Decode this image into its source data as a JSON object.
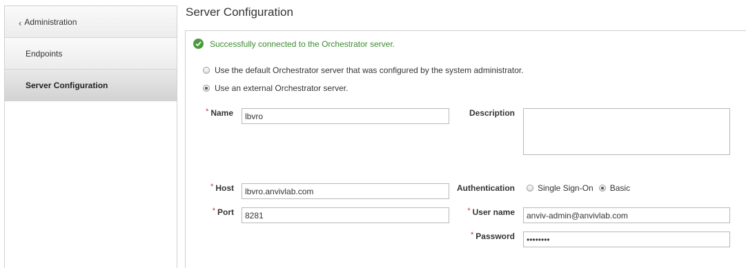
{
  "sidebar": {
    "items": [
      {
        "label": "Administration"
      },
      {
        "label": "Endpoints"
      },
      {
        "label": "Server Configuration"
      }
    ]
  },
  "page": {
    "title": "Server Configuration"
  },
  "status": {
    "message": "Successfully connected to the Orchestrator server."
  },
  "server_choice": {
    "default_label": "Use the default Orchestrator server that was configured by the system administrator.",
    "external_label": "Use an external Orchestrator server.",
    "selected": "external"
  },
  "form": {
    "required_mark": "*",
    "name": {
      "label": "Name",
      "value": "lbvro"
    },
    "description": {
      "label": "Description",
      "value": ""
    },
    "host": {
      "label": "Host",
      "value": "lbvro.anvivlab.com"
    },
    "port": {
      "label": "Port",
      "value": "8281"
    },
    "authentication": {
      "label": "Authentication",
      "options": [
        "Single Sign-On",
        "Basic"
      ],
      "selected": "Basic"
    },
    "username": {
      "label": "User name",
      "value": "anviv-admin@anvivlab.com"
    },
    "password": {
      "label": "Password",
      "value": "password"
    }
  },
  "colors": {
    "success": "#3b8c2e",
    "required": "#c0392b"
  }
}
